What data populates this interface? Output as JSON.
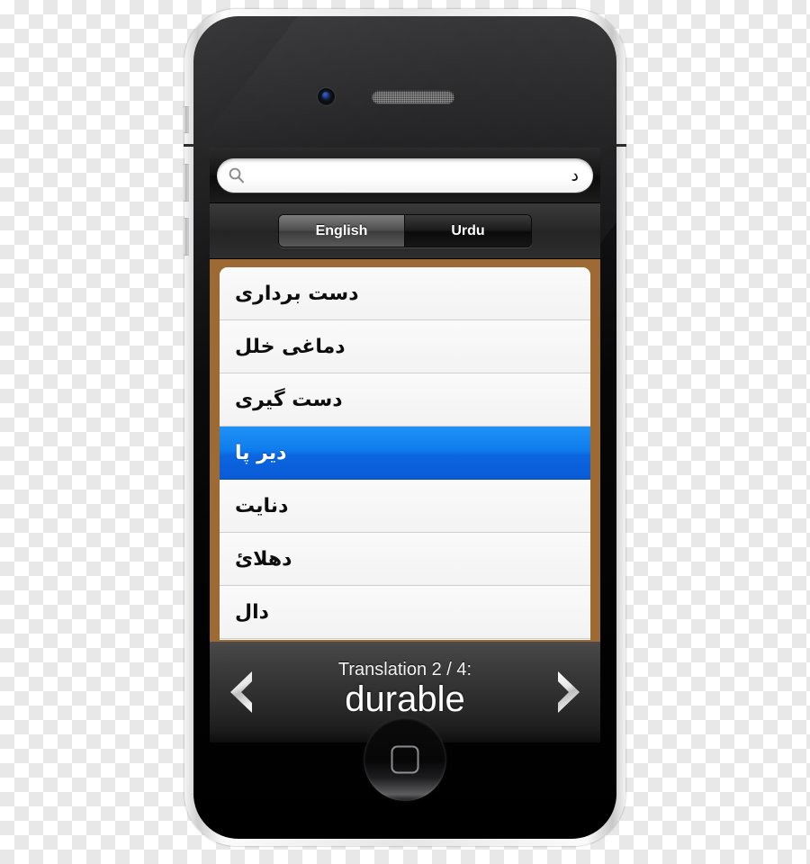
{
  "app": {
    "device": "iphone-4",
    "accent_brown": "#9d6a33",
    "selection_blue": "#0f7ced"
  },
  "search": {
    "icon": "search-icon",
    "value": "د",
    "placeholder": ""
  },
  "language_tabs": {
    "items": [
      {
        "label": "English",
        "selected": true
      },
      {
        "label": "Urdu",
        "selected": false
      }
    ]
  },
  "results": {
    "items": [
      {
        "word": "دست برداری",
        "selected": false
      },
      {
        "word": "دماغی خلل",
        "selected": false
      },
      {
        "word": "دست گیری",
        "selected": false
      },
      {
        "word": "دیر پا",
        "selected": true
      },
      {
        "word": "دنایت",
        "selected": false
      },
      {
        "word": "دهلائ",
        "selected": false
      },
      {
        "word": "دال",
        "selected": false
      }
    ]
  },
  "translation": {
    "label": "Translation 2 / 4:",
    "word": "durable",
    "index": 2,
    "total": 4,
    "prev_icon": "chevron-left-icon",
    "next_icon": "chevron-right-icon"
  }
}
